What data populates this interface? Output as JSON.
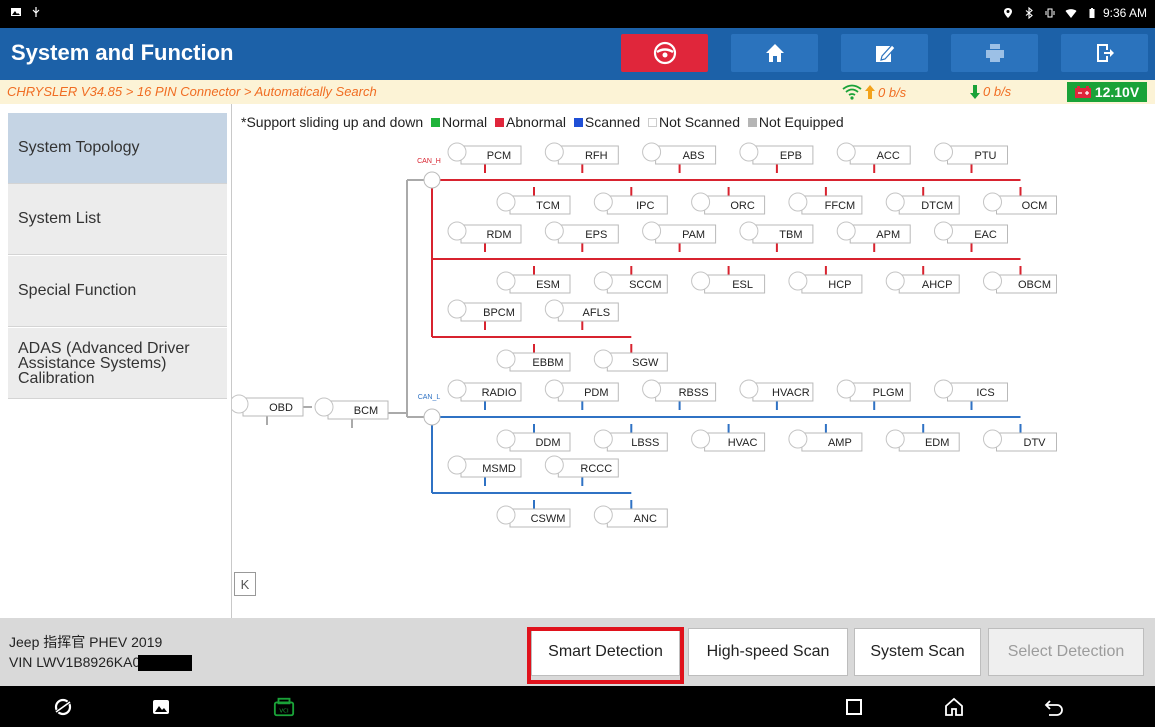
{
  "status_bar": {
    "time": "9:36 AM"
  },
  "header": {
    "title": "System and Function",
    "buttons": [
      {
        "name": "vci-button",
        "icon": "vci-steering-icon"
      },
      {
        "name": "home-button",
        "icon": "home-icon"
      },
      {
        "name": "report-button",
        "icon": "edit-note-icon"
      },
      {
        "name": "print-button",
        "icon": "printer-icon"
      },
      {
        "name": "exit-button",
        "icon": "exit-icon"
      }
    ]
  },
  "crumb": {
    "path": "CHRYSLER V34.85 > 16 PIN Connector > Automatically Search",
    "up_rate": "0 b/s",
    "down_rate": "0 b/s",
    "voltage": "12.10V"
  },
  "menu": [
    {
      "label": "System Topology",
      "active": true
    },
    {
      "label": "System List",
      "active": false
    },
    {
      "label": "Special Function",
      "active": false
    },
    {
      "label": "ADAS (Advanced Driver Assistance Systems) Calibration",
      "active": false
    }
  ],
  "legend": {
    "prefix": "*Support sliding up and down",
    "items": [
      {
        "label": "Normal",
        "color": "#1fb33a"
      },
      {
        "label": "Abnormal",
        "color": "#e0263b"
      },
      {
        "label": "Scanned",
        "color": "#1f4fd6"
      },
      {
        "label": "Not Scanned",
        "color": "#ffffff"
      },
      {
        "label": "Not Equipped",
        "color": "#b5b5b5"
      }
    ]
  },
  "topology": {
    "root": "OBD",
    "gateway": "BCM",
    "can_h": {
      "label": "CAN_H",
      "color": "#d8232f",
      "rows": [
        {
          "up": [
            "PCM",
            "RFH",
            "ABS",
            "EPB",
            "ACC",
            "PTU"
          ],
          "down": [
            "TCM",
            "IPC",
            "ORC",
            "FFCM",
            "DTCM",
            "OCM"
          ]
        },
        {
          "up": [
            "RDM",
            "EPS",
            "PAM",
            "TBM",
            "APM",
            "EAC"
          ],
          "down": [
            "ESM",
            "SCCM",
            "ESL",
            "HCP",
            "AHCP",
            "OBCM"
          ]
        },
        {
          "up": [
            "BPCM",
            "AFLS"
          ],
          "down": [
            "EBBM",
            "SGW"
          ]
        }
      ]
    },
    "can_l": {
      "label": "CAN_L",
      "color": "#2f72c4",
      "rows": [
        {
          "up": [
            "RADIO",
            "PDM",
            "RBSS",
            "HVACR",
            "PLGM",
            "ICS"
          ],
          "down": [
            "DDM",
            "LBSS",
            "HVAC",
            "AMP",
            "EDM",
            "DTV"
          ]
        },
        {
          "up": [
            "MSMD",
            "RCCC"
          ],
          "down": [
            "CSWM",
            "ANC"
          ]
        }
      ]
    }
  },
  "collapse_label": "K",
  "vehicle": {
    "model": "Jeep 指挥官 PHEV 2019",
    "vin": "VIN LWV1B8926KA0"
  },
  "actions": {
    "smart": "Smart Detection",
    "highspeed": "High-speed Scan",
    "system": "System Scan",
    "select": "Select Detection"
  }
}
